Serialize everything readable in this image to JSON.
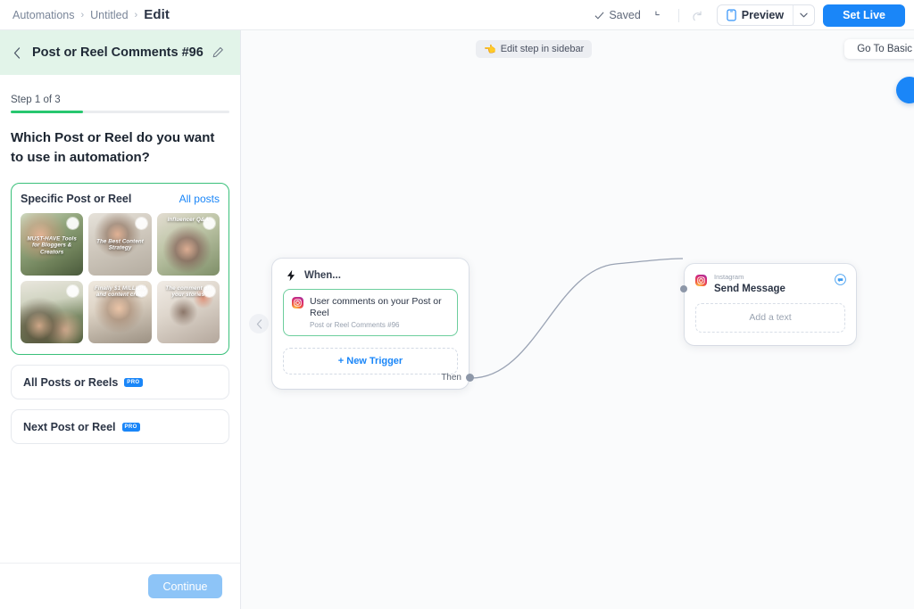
{
  "breadcrumb": {
    "root": "Automations",
    "sep": "›",
    "mid": "Untitled",
    "current": "Edit"
  },
  "topbar": {
    "saved_label": "Saved",
    "check_icon": "check-icon",
    "undo_icon": "undo-icon",
    "redo_icon": "redo-icon",
    "preview_label": "Preview",
    "preview_icon": "phone-icon",
    "preview_caret_icon": "chevron-down-icon",
    "set_live_label": "Set Live",
    "accent_blue": "#1a86f8"
  },
  "sidebar": {
    "back_icon": "chevron-left-icon",
    "title": "Post or Reel Comments #96",
    "edit_icon": "pencil-icon",
    "header_bg": "#e2f4e9",
    "step_label": "Step 1 of 3",
    "progress_percent": 33,
    "progress_color": "#28c76f",
    "question": "Which Post or Reel do you want to use in automation?",
    "specific_card": {
      "title": "Specific Post or Reel",
      "all_posts_link": "All posts",
      "border_color": "#39c07a",
      "thumbnails": [
        {
          "caption": "MUST-HAVE Tools for Bloggers & Creators",
          "caption_pos": "mid",
          "selected": true
        },
        {
          "caption": "The Best Content Strategy",
          "caption_pos": "mid",
          "selected": true
        },
        {
          "caption": "Influencer Q&A",
          "caption_pos": "top",
          "selected": true
        },
        {
          "caption": "",
          "caption_pos": "top",
          "selected": true
        },
        {
          "caption": "Finally $1 MILLION and content creat",
          "caption_pos": "top",
          "selected": true
        },
        {
          "caption": "The comment on your stories",
          "caption_pos": "top",
          "selected": true
        }
      ]
    },
    "options": [
      {
        "label": "All Posts or Reels",
        "badge": "PRO"
      },
      {
        "label": "Next Post or Reel",
        "badge": "PRO"
      }
    ],
    "continue_label": "Continue"
  },
  "canvas": {
    "edit_pill_label": "Edit step in sidebar",
    "edit_pill_icon": "pointing-left-hand-icon",
    "go_to_basic_label": "Go To Basic",
    "fab_icon": "help-circle-icon",
    "collapse_icon": "chevron-left-icon",
    "trigger_node": {
      "when_label": "When...",
      "when_icon": "lightning-bolt-icon",
      "trigger_title": "User comments on your Post or Reel",
      "trigger_subtitle": "Post or Reel Comments #96",
      "trigger_icon": "instagram-icon",
      "new_trigger_label": "+ New Trigger",
      "then_label": "Then"
    },
    "action_node": {
      "platform": "Instagram",
      "title": "Send Message",
      "platform_icon": "instagram-icon",
      "chat_icon": "chat-bubble-icon",
      "placeholder": "Add a text"
    }
  }
}
